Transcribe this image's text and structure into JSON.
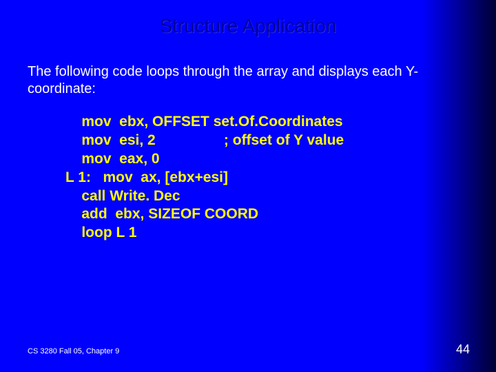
{
  "title": "Structure Application",
  "description": "The following code loops through the array and displays each Y-coordinate:",
  "code": "    mov  ebx, OFFSET set.Of.Coordinates\n    mov  esi, 2                 ; offset of Y value\n    mov  eax, 0\nL 1:   mov  ax, [ebx+esi]\n    call Write. Dec\n    add  ebx, SIZEOF COORD\n    loop L 1",
  "footer": {
    "left": "CS 3280 Fall 05, Chapter 9",
    "right": "44"
  }
}
